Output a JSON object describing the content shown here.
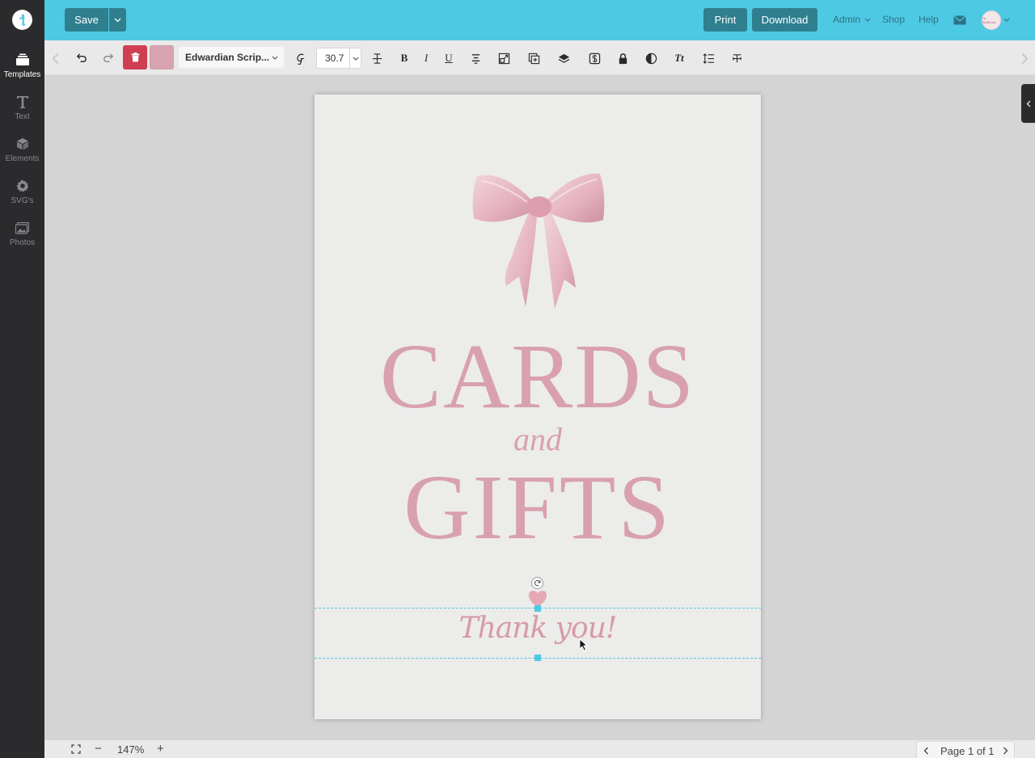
{
  "app": {
    "name": "Templett",
    "logo_glyph": "t"
  },
  "sidebar": {
    "items": [
      {
        "label": "Templates",
        "icon": "templates-icon",
        "active": true
      },
      {
        "label": "Text",
        "icon": "text-icon",
        "active": false
      },
      {
        "label": "Elements",
        "icon": "cube-icon",
        "active": false
      },
      {
        "label": "SVG's",
        "icon": "gear-icon",
        "active": false
      },
      {
        "label": "Photos",
        "icon": "photo-icon",
        "active": false
      }
    ]
  },
  "header": {
    "save_label": "Save",
    "print_label": "Print",
    "download_label": "Download",
    "admin_label": "Admin",
    "shop_label": "Shop",
    "help_label": "Help",
    "avatar_text": "In Bulloom"
  },
  "toolbar": {
    "font_name": "Edwardian Scrip...",
    "font_size": "30.7",
    "text_color": "#d7a3b0",
    "tools": [
      "undo-icon",
      "redo-icon",
      "trash-icon",
      "font-style-icon",
      "letter-spacing-icon",
      "bold-icon",
      "italic-icon",
      "underline-icon",
      "align-icon",
      "resize-icon",
      "duplicate-icon",
      "layers-icon",
      "dollar-icon",
      "lock-icon",
      "opacity-icon",
      "text-case-icon",
      "line-height-icon",
      "text-fit-icon"
    ],
    "bold_glyph": "B",
    "italic_glyph": "I",
    "underline_glyph": "U",
    "case_glyph": "Tt"
  },
  "design": {
    "line1": "CARDS",
    "line2": "and",
    "line3": "GIFTS",
    "footer": "Thank you!",
    "accent_color": "#d8a1ad",
    "paper_color": "#ececeb"
  },
  "bottom": {
    "zoom_level": "147%",
    "zoom_out": "−",
    "zoom_in": "+",
    "page_indicator": "Page 1 of 1"
  },
  "colors": {
    "header_bg": "#4ec9e3",
    "button_bg": "#2f7f8f",
    "sidebar_bg": "#2b2b2d",
    "delete_bg": "#cf3e51",
    "selection": "#55c7e2"
  }
}
